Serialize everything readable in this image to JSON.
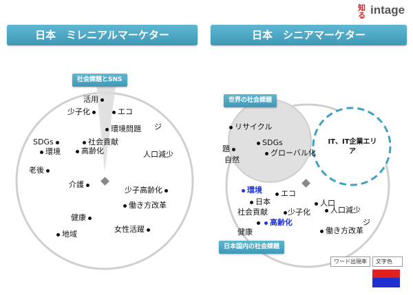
{
  "brand": {
    "logo_text": "intage",
    "kanji_mark": "知る"
  },
  "left_panel": {
    "title": "日本　ミレニアルマーケター",
    "tag": "社会課題とSNS",
    "words": [
      {
        "label": "活用"
      },
      {
        "label": "少子化"
      },
      {
        "label": "エコ"
      },
      {
        "label": "環境問題"
      },
      {
        "label": "ジ"
      },
      {
        "label": "SDGs"
      },
      {
        "label": "社会貢献"
      },
      {
        "label": "環境"
      },
      {
        "label": "高齢化"
      },
      {
        "label": "人口減少"
      },
      {
        "label": "老後"
      },
      {
        "label": "介護"
      },
      {
        "label": "少子高齢化"
      },
      {
        "label": "働き方改革"
      },
      {
        "label": "健康"
      },
      {
        "label": "女性活躍"
      },
      {
        "label": "地域"
      }
    ]
  },
  "right_panel": {
    "title": "日本　シニアマーケター",
    "world_tag": "世界の社会課題",
    "domestic_tag": "日本国内の社会課題",
    "it_zone": "IT、IT企業エリア",
    "words": [
      {
        "label": "リサイクル"
      },
      {
        "label": "SDGs"
      },
      {
        "label": "グローバル化"
      },
      {
        "label": "題"
      },
      {
        "label": "自然"
      },
      {
        "label": "環境"
      },
      {
        "label": "エコ"
      },
      {
        "label": "日本"
      },
      {
        "label": "人口"
      },
      {
        "label": "人口減少"
      },
      {
        "label": "社会貢献"
      },
      {
        "label": "少子化"
      },
      {
        "label": "高齢化"
      },
      {
        "label": "ジ"
      },
      {
        "label": "働き方改革"
      },
      {
        "label": "健康"
      }
    ]
  },
  "legend": {
    "size_label": "ワード出現率",
    "color_label": "文字色"
  },
  "colors": {
    "accent": "#4aa8c6",
    "highlight_word": "#1f35d8",
    "flag_top": "#e02020",
    "flag_bottom": "#2030d0"
  }
}
